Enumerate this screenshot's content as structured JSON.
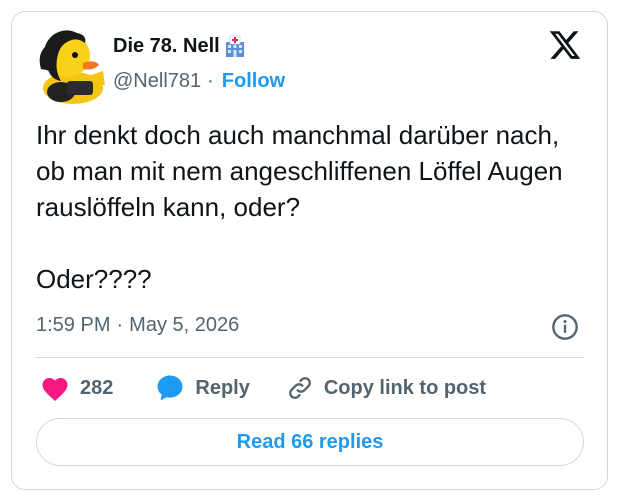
{
  "author": {
    "name": "Die 78. Nell",
    "handle": "@Nell781",
    "follow_label": "Follow",
    "badge_icon": "hospital-icon",
    "avatar_icon": "rubber-duck-avatar"
  },
  "tweet": {
    "text": "Ihr denkt doch auch manchmal darüber nach, ob man mit nem angeschliffenen Löffel Augen rauslöffeln kann, oder?\n\nOder????",
    "time": "1:59 PM",
    "date": "May 5, 2026"
  },
  "actions": {
    "like_count": "282",
    "reply_label": "Reply",
    "copy_label": "Copy link to post"
  },
  "read_replies_label": "Read 66 replies",
  "colors": {
    "accent": "#1d9bf0",
    "like": "#f91880",
    "secondary_text": "#536471",
    "border": "#cfd9de"
  }
}
